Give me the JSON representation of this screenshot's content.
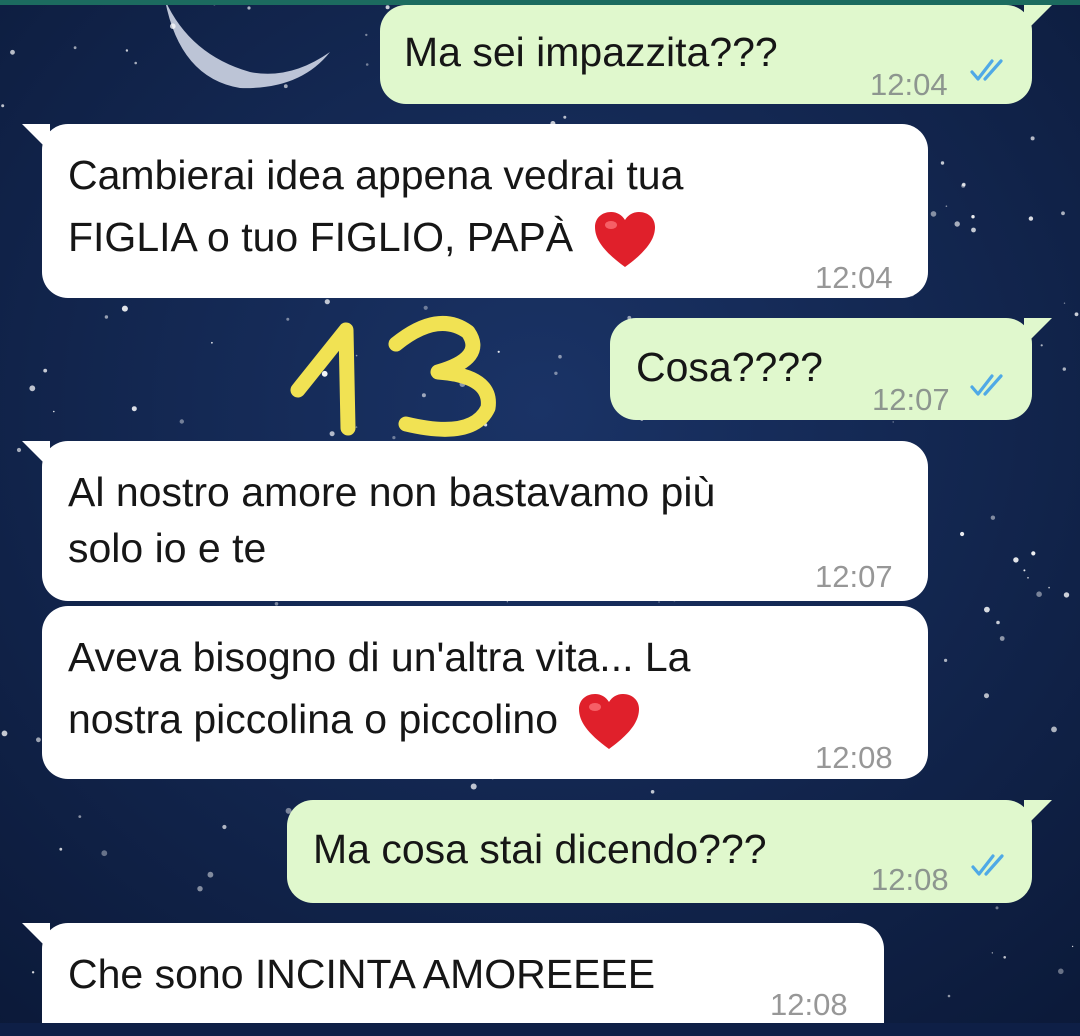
{
  "overlay_number": "13",
  "colors": {
    "background": "#0e1f46",
    "outgoing_bubble": "#e0f8cd",
    "incoming_bubble": "#ffffff",
    "read_ticks": "#4fa9e6",
    "overlay_number": "#f1e253"
  },
  "messages": [
    {
      "direction": "outgoing",
      "lines": [
        "Ma sei impazzita???"
      ],
      "time": "12:04",
      "status": "read-double-check-icon"
    },
    {
      "direction": "incoming",
      "lines": [
        "Cambierai idea appena vedrai tua",
        "FIGLIA o tuo FIGLIO, PAPÀ"
      ],
      "emoji": "heart-icon",
      "time": "12:04"
    },
    {
      "direction": "outgoing",
      "lines": [
        "Cosa????"
      ],
      "time": "12:07",
      "status": "read-double-check-icon"
    },
    {
      "direction": "incoming",
      "lines": [
        "Al nostro amore non bastavamo più",
        "solo io e te"
      ],
      "time": "12:07"
    },
    {
      "direction": "incoming",
      "lines": [
        "Aveva bisogno di un'altra vita... La",
        "nostra piccolina o piccolino"
      ],
      "emoji": "heart-icon",
      "time": "12:08"
    },
    {
      "direction": "outgoing",
      "lines": [
        "Ma cosa stai dicendo???"
      ],
      "time": "12:08",
      "status": "read-double-check-icon"
    },
    {
      "direction": "incoming",
      "lines": [
        "Che sono INCINTA AMOREEEE"
      ],
      "time": "12:08"
    }
  ]
}
